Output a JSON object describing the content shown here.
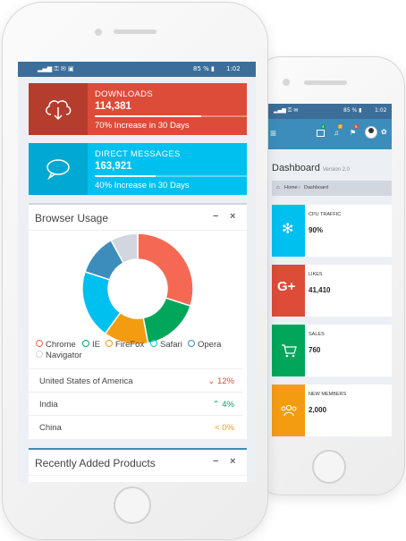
{
  "front": {
    "status": {
      "left_icons": "▂▄▆ ⚿ ✉ ▣",
      "battery": "85 % ▮",
      "time": "1:02"
    },
    "cards": [
      {
        "title": "DOWNLOADS",
        "value": "114,381",
        "desc": "70% Increase in 30 Days",
        "progress": 0.7,
        "color": "#dd4b39",
        "icon": "cloud-download-icon"
      },
      {
        "title": "DIRECT MESSAGES",
        "value": "163,921",
        "desc": "40% Increase in 30 Days",
        "progress": 0.4,
        "color": "#00c0ef",
        "icon": "chat-bubble-icon"
      }
    ],
    "browser_box": {
      "title": "Browser Usage",
      "minimize": "−",
      "close": "×",
      "rows": [
        {
          "country": "United States of America",
          "percent": "12%",
          "arrow": "⌄",
          "color": "#dd4b39"
        },
        {
          "country": "India",
          "percent": "4%",
          "arrow": "⌃",
          "color": "#00a65a"
        },
        {
          "country": "China",
          "percent": "0%",
          "arrow": "<",
          "color": "#f39c12"
        }
      ]
    },
    "products_box": {
      "title": "Recently Added Products",
      "minimize": "−",
      "close": "×"
    }
  },
  "chart_data": {
    "type": "pie",
    "donut": true,
    "categories": [
      "Chrome",
      "IE",
      "FireFox",
      "Safari",
      "Opera",
      "Navigator"
    ],
    "values": [
      30,
      17,
      13,
      20,
      12,
      8
    ],
    "colors": [
      "#f56954",
      "#00a65a",
      "#f39c12",
      "#00c0ef",
      "#3c8dbc",
      "#d2d6de"
    ],
    "legend_position": "bottom"
  },
  "back": {
    "status": {
      "left_icons": "▂▄▆ ⚿ ✉",
      "battery": "85 % ▮",
      "time": "1:02"
    },
    "header": {
      "menu_icon": "≡",
      "badges": [
        "4",
        "3",
        "5"
      ]
    },
    "page_title": "Dashboard",
    "page_subtitle": "Version 2.0",
    "breadcrumb": {
      "home": "Home",
      "sep": "›",
      "current": "Dashboard"
    },
    "tiles": [
      {
        "label": "CPU TRAFFIC",
        "value": "90%",
        "color": "#00c0ef",
        "icon": "gear-icon"
      },
      {
        "label": "LIKES",
        "value": "41,410",
        "color": "#dd4b39",
        "icon": "google-plus-icon"
      },
      {
        "label": "SALES",
        "value": "760",
        "color": "#00a65a",
        "icon": "shopping-cart-icon"
      },
      {
        "label": "NEW MEMBERS",
        "value": "2,000",
        "color": "#f39c12",
        "icon": "users-icon"
      }
    ]
  }
}
